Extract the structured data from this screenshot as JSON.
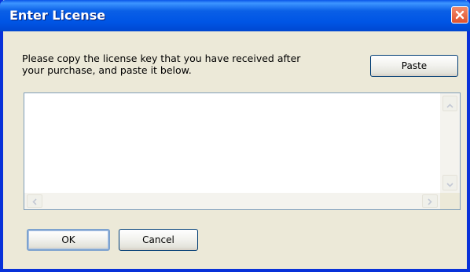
{
  "window": {
    "title": "Enter License"
  },
  "instructions": {
    "line1": "Please copy the license key that you have received after",
    "line2": "your purchase, and paste it below."
  },
  "buttons": {
    "paste_label": "Paste",
    "ok_label": "OK",
    "cancel_label": "Cancel"
  },
  "license_field": {
    "value": ""
  },
  "colors": {
    "titlebar": "#0055e5",
    "window_bg": "#ece9d8",
    "border": "#0831d9",
    "close_button": "#e0512c"
  },
  "icons": {
    "close": "close-icon",
    "scroll_up": "chevron-up-icon",
    "scroll_down": "chevron-down-icon",
    "scroll_left": "chevron-left-icon",
    "scroll_right": "chevron-right-icon"
  }
}
